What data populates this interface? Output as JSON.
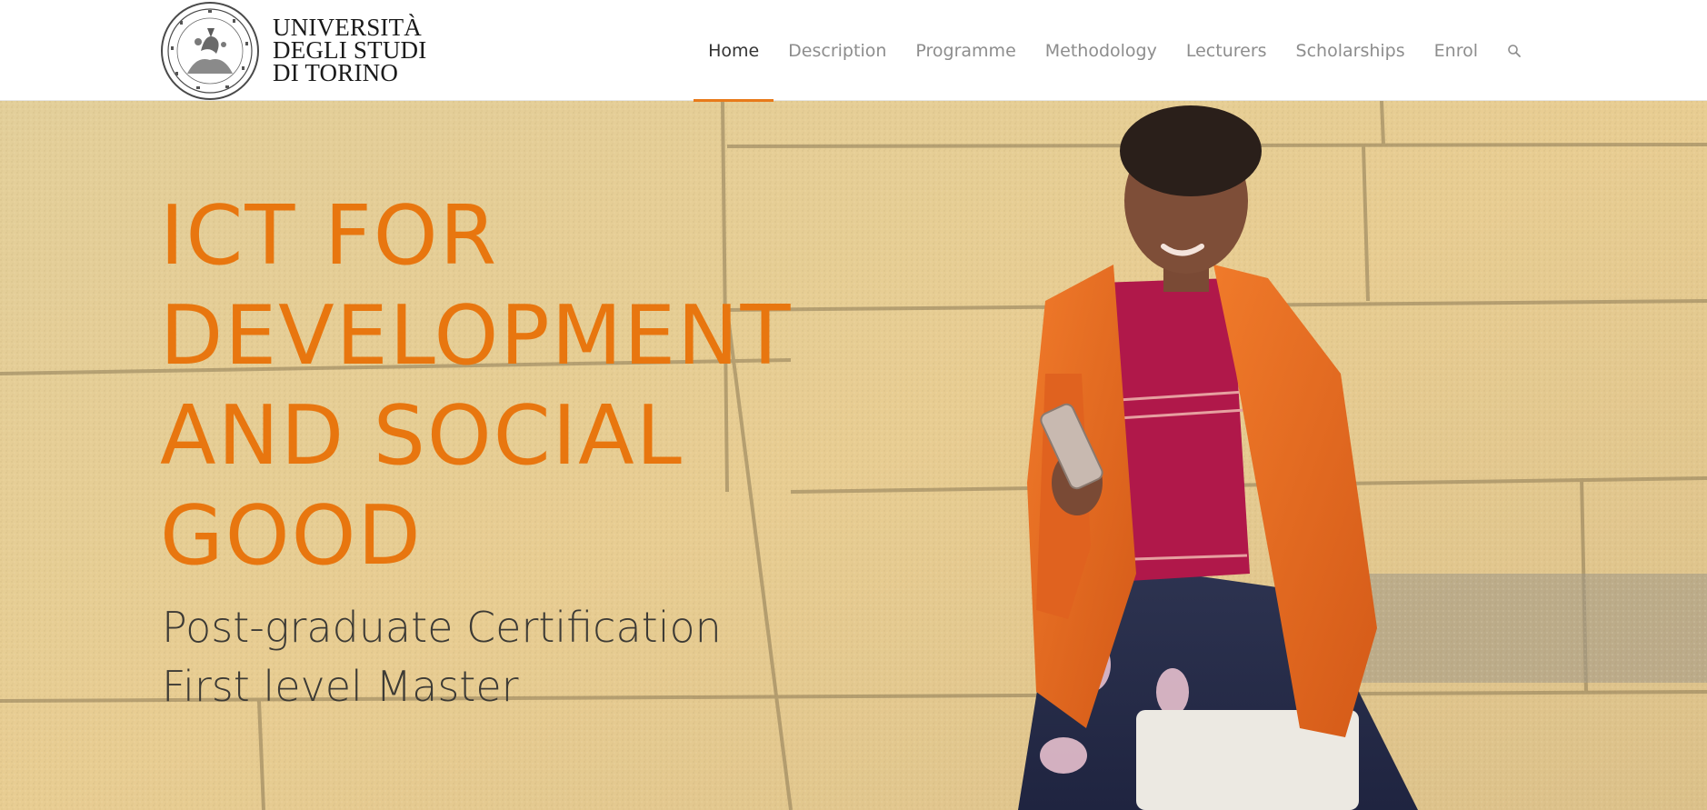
{
  "header": {
    "logo": {
      "line1": "UNIVERSITÀ",
      "line2": "DEGLI STUDI",
      "line3": "DI TORINO"
    },
    "nav": [
      {
        "label": "Home",
        "active": true
      },
      {
        "label": "Description",
        "active": false
      },
      {
        "label": "Programme",
        "active": false
      },
      {
        "label": "Methodology",
        "active": false
      },
      {
        "label": "Lecturers",
        "active": false
      },
      {
        "label": "Scholarships",
        "active": false
      },
      {
        "label": "Enrol",
        "active": false
      }
    ],
    "search_icon": "search-icon"
  },
  "hero": {
    "title_lines": [
      "ICT FOR",
      "DEVELOPMENT",
      "AND SOCIAL",
      "GOOD"
    ],
    "subtitle_lines": [
      "Post-graduate Certification",
      "First level Master"
    ]
  },
  "colors": {
    "accent": "#e8760f",
    "nav_text": "#8d8d8d",
    "nav_active": "#333333",
    "subtitle": "#3c3a35"
  }
}
